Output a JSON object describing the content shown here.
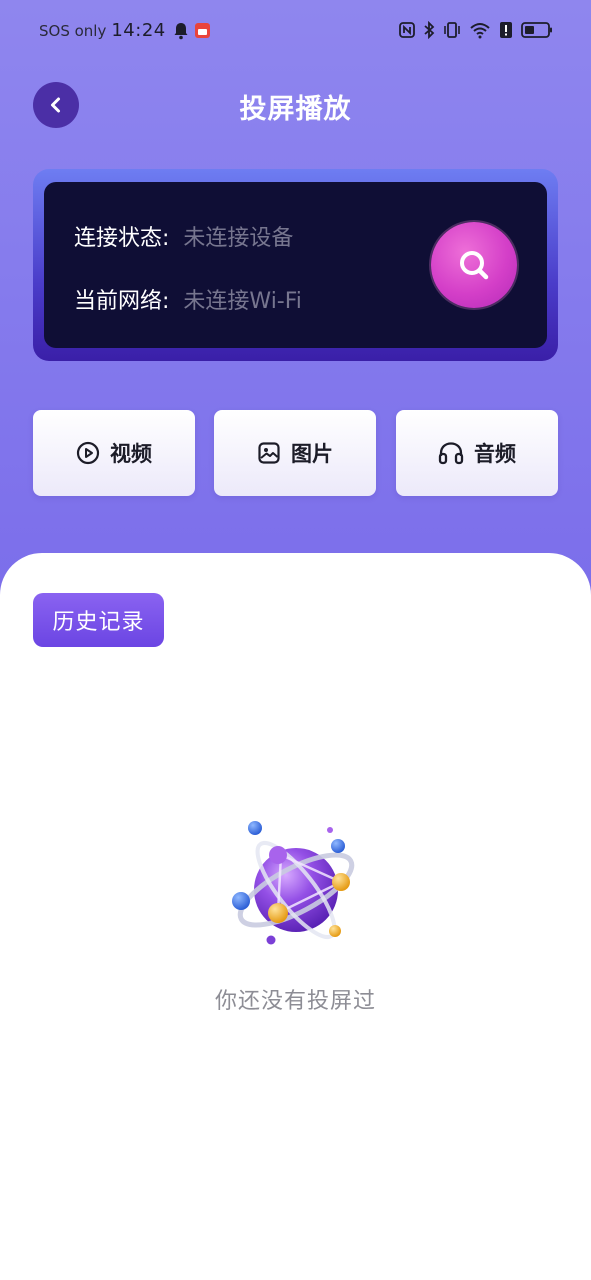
{
  "status_bar": {
    "carrier": "SOS only",
    "time": "14:24",
    "icons": [
      "bell-icon",
      "app-notification-icon",
      "nfc-icon",
      "bluetooth-icon",
      "vibrate-icon",
      "wifi-icon",
      "alert-icon",
      "battery-icon"
    ]
  },
  "header": {
    "title": "投屏播放",
    "back_icon": "chevron-left-icon"
  },
  "connection": {
    "status_label": "连接状态:",
    "status_value": "未连接设备",
    "network_label": "当前网络:",
    "network_value": "未连接Wi-Fi",
    "search_icon": "search-icon"
  },
  "media_buttons": [
    {
      "label": "视频",
      "icon": "play-circle-icon"
    },
    {
      "label": "图片",
      "icon": "image-icon"
    },
    {
      "label": "音频",
      "icon": "headphones-icon"
    }
  ],
  "history": {
    "tab_label": "历史记录",
    "empty_text": "你还没有投屏过",
    "illustration": "planet-icon"
  },
  "colors": {
    "header_gradient_top": "#8f86ee",
    "header_gradient_bottom": "#7a6cea",
    "card_bg": "#0f0e35",
    "search_button": "#d43fc8",
    "history_tab": "#7550e8",
    "back_button": "#4b2fa6"
  }
}
